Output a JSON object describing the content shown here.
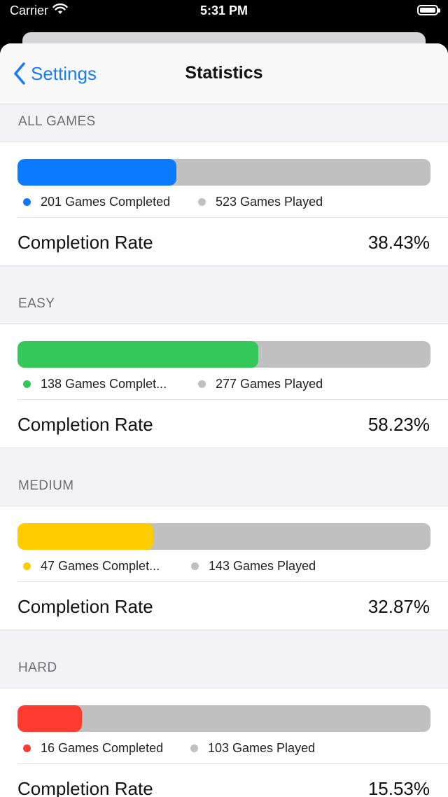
{
  "status_bar": {
    "carrier": "Carrier",
    "time": "5:31 PM"
  },
  "nav": {
    "back_label": "Settings",
    "title": "Statistics"
  },
  "colors": {
    "accent": "#1a7cf5",
    "track": "#c0c0c0",
    "played_dot": "#c0c0c0"
  },
  "sections": [
    {
      "id": "all",
      "header": "ALL GAMES",
      "color": "#0a7aff",
      "completed_label": "201 Games Completed",
      "played_label": "523 Games Played",
      "rate_label": "Completion Rate",
      "rate_value": "38.43%",
      "fraction": 0.3843
    },
    {
      "id": "easy",
      "header": "EASY",
      "color": "#34c759",
      "completed_label": "138 Games Complet...",
      "played_label": "277 Games Played",
      "rate_label": "Completion Rate",
      "rate_value": "58.23%",
      "fraction": 0.5823
    },
    {
      "id": "medium",
      "header": "MEDIUM",
      "color": "#ffcc00",
      "completed_label": "47 Games Complet...",
      "played_label": "143 Games Played",
      "rate_label": "Completion Rate",
      "rate_value": "32.87%",
      "fraction": 0.3287
    },
    {
      "id": "hard",
      "header": "HARD",
      "color": "#ff3b30",
      "completed_label": "16 Games Completed",
      "played_label": "103 Games Played",
      "rate_label": "Completion Rate",
      "rate_value": "15.53%",
      "fraction": 0.1553
    }
  ]
}
